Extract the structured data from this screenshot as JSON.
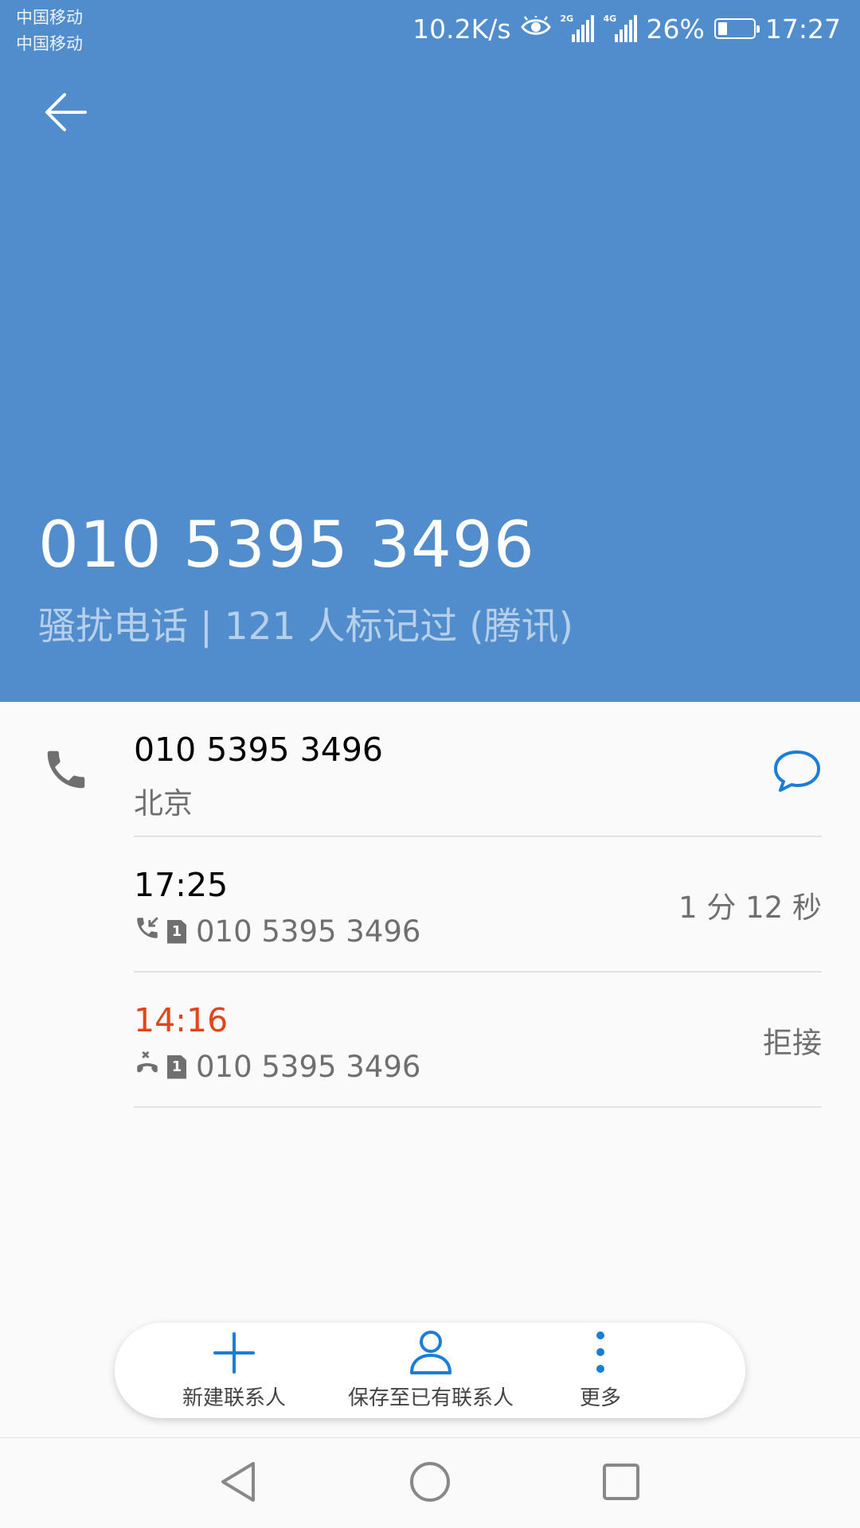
{
  "status_bar": {
    "carrier_1": "中国移动",
    "carrier_2": "中国移动",
    "net_speed": "10.2K/s",
    "sim1_network": "2G",
    "sim2_network": "4G",
    "battery_percent": "26%",
    "battery_level": 0.26,
    "time": "17:27"
  },
  "header": {
    "background_color": "#518dcc",
    "back_icon": "arrow-left-icon",
    "phone_number": "010 5395 3496",
    "tag_line": "骚扰电话 | 121 人标记过 (腾讯)"
  },
  "number_row": {
    "number": "010 5395 3496",
    "location": "北京",
    "call_icon": "phone-icon",
    "message_icon": "message-bubble-icon",
    "accent_color": "#1a7ed8"
  },
  "call_log": [
    {
      "time": "17:25",
      "type_icon": "incoming-call-icon",
      "sim": "1",
      "number": "010 5395 3496",
      "detail": "1 分 12 秒"
    },
    {
      "time": "14:16",
      "type_icon": "rejected-call-icon",
      "sim": "1",
      "number": "010 5395 3496",
      "detail": "拒接",
      "time_color": "#e0461a"
    }
  ],
  "actions": {
    "new_contact": "新建联系人",
    "save_existing": "保存至已有联系人",
    "more": "更多"
  },
  "nav": {
    "back": "triangle-back-icon",
    "home": "circle-home-icon",
    "recents": "square-recents-icon"
  }
}
